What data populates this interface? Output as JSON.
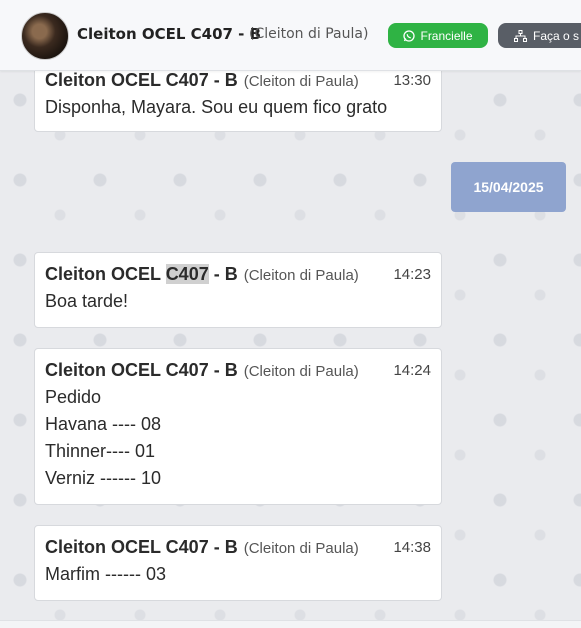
{
  "header": {
    "name": "Cleiton OCEL C407 - B",
    "sub": "(Cleiton di Paula)",
    "whatsapp_button": "Francielle",
    "second_button": "Faça o s"
  },
  "date_badge": "15/04/2025",
  "messages": [
    {
      "author": "Cleiton OCEL C407 - B",
      "sub": "(Cleiton di Paula)",
      "time": "13:30",
      "lines": [
        "Disponha, Mayara. Sou eu quem fico grato"
      ]
    },
    {
      "author_pre": "Cleiton OCEL ",
      "author_hl": "C407",
      "author_post": " - B",
      "sub": "(Cleiton di Paula)",
      "time": "14:23",
      "lines": [
        "Boa tarde!"
      ]
    },
    {
      "author": "Cleiton OCEL C407 - B",
      "sub": "(Cleiton di Paula)",
      "time": "14:24",
      "lines": [
        "Pedido",
        "Havana ---- 08",
        "Thinner---- 01",
        "Verniz ------ 10"
      ]
    },
    {
      "author": "Cleiton OCEL C407 - B",
      "sub": "(Cleiton di Paula)",
      "time": "14:38",
      "lines": [
        "Marfim ------ 03"
      ]
    }
  ],
  "colors": {
    "green_button": "#2fb344",
    "date_badge": "#8fa4cf",
    "dark_button": "#595e66"
  }
}
